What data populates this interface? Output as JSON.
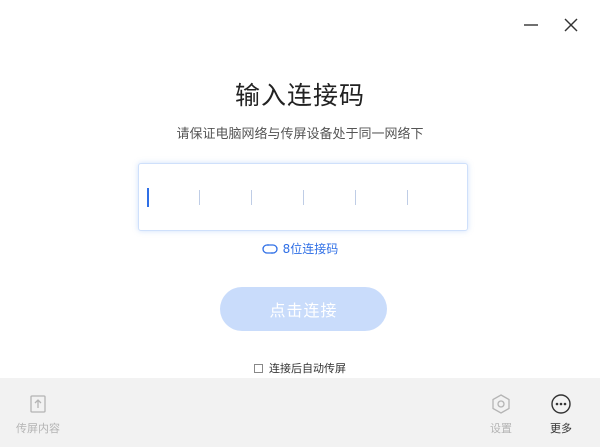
{
  "window": {
    "minimize_icon": "minimize-icon",
    "close_icon": "close-icon"
  },
  "main": {
    "title": "输入连接码",
    "subtitle": "请保证电脑网络与传屏设备处于同一网络下",
    "code_input": {
      "value": "",
      "slots": 6,
      "active_slot": 0
    },
    "switch_mode_label": "8位连接码",
    "connect_button_label": "点击连接",
    "auto_cast_label": "连接后自动传屏",
    "auto_cast_checked": false
  },
  "bottom_bar": {
    "cast_content_label": "传屏内容",
    "settings_label": "设置",
    "more_label": "更多"
  },
  "colors": {
    "accent": "#2f6fe6",
    "button_disabled": "#c9dcfb",
    "bar_background": "#f2f2f2"
  }
}
